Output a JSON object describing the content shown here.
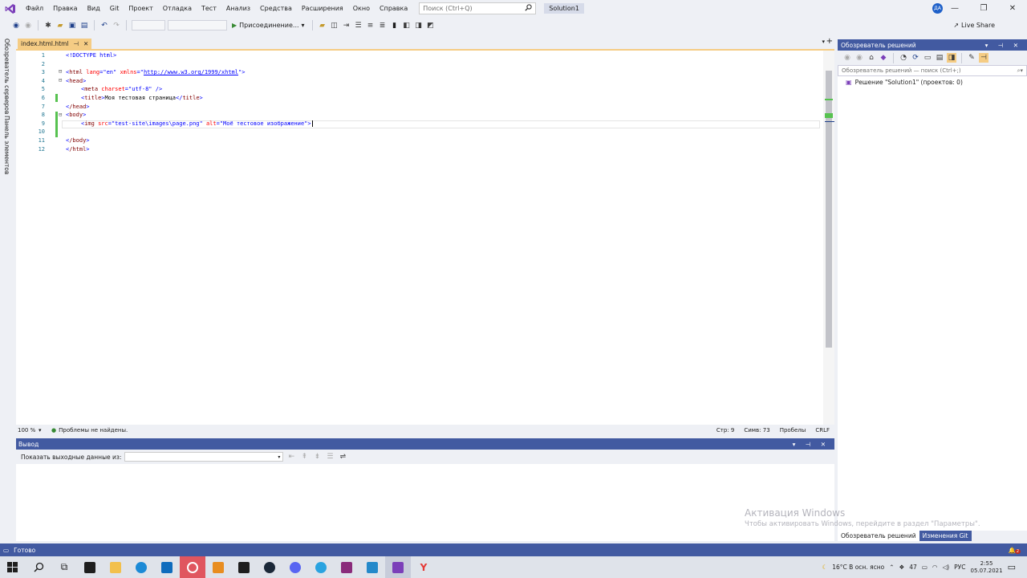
{
  "menu": {
    "items": [
      "Файл",
      "Правка",
      "Вид",
      "Git",
      "Проект",
      "Отладка",
      "Тест",
      "Анализ",
      "Средства",
      "Расширения",
      "Окно",
      "Справка"
    ],
    "search_placeholder": "Поиск (Ctrl+Q)",
    "solution_name": "Solution1",
    "avatar_initials": "ДА"
  },
  "toolbar": {
    "run_label": "Присоединение...",
    "live_share": "Live Share"
  },
  "left_rail": {
    "tab1": "Обозреватель серверов",
    "tab2": "Панель элементов"
  },
  "editor": {
    "tab_name": "index.html.html",
    "zoom": "100 %",
    "issues": "Проблемы не найдены.",
    "line": "Стр: 9",
    "col": "Симв: 73",
    "spaces": "Пробелы",
    "eol": "CRLF"
  },
  "code": {
    "l1_doctype": "<!DOCTYPE html>",
    "l3_open": "<",
    "l3_tag": "html",
    "l3_attr1": " lang",
    "l3_eq1": "=",
    "l3_val1": "\"en\"",
    "l3_attr2": " xmlns",
    "l3_eq2": "=",
    "l3_q1": "\"",
    "l3_link": "http://www.w3.org/1999/xhtml",
    "l3_q2": "\"",
    "l3_close": ">",
    "l4_text": "head",
    "l5_tag": "meta",
    "l5_attr": " charset",
    "l5_val": "\"utf-8\"",
    "l5_close": " />",
    "l6_tag": "title",
    "l6_text": "Моя тестовая страница",
    "l6_endtag": "title",
    "l7_text": "/head",
    "l8_text": "body",
    "l9_tag": "img",
    "l9_attr1": " src",
    "l9_val1": "\"test-site\\images\\page.png\"",
    "l9_attr2": " alt",
    "l9_val2": "\"Моё тестовое изображение\"",
    "l11_text": "/body",
    "l12_text": "/html",
    "line_numbers": [
      "1",
      "2",
      "3",
      "4",
      "5",
      "6",
      "7",
      "8",
      "9",
      "10",
      "11",
      "12"
    ]
  },
  "output": {
    "title": "Вывод",
    "show_from_label": "Показать выходные данные из:"
  },
  "solution_explorer": {
    "title": "Обозреватель решений",
    "search_placeholder": "Обозреватель решений — поиск (Ctrl+;)",
    "solution_item": "Решение \"Solution1\" (проектов: 0)",
    "bottom_tab1": "Обозреватель решений",
    "bottom_tab2": "Изменения Git"
  },
  "watermark": {
    "line1": "Активация Windows",
    "line2": "Чтобы активировать Windows, перейдите в раздел \"Параметры\"."
  },
  "status": {
    "ready": "Готово"
  },
  "taskbar": {
    "weather": "16°C  В осн. ясно",
    "count": "47",
    "lang": "РУС",
    "time": "2:55",
    "date": "05.07.2021",
    "notif_count": "2"
  },
  "colors": {
    "accent": "#425aa1",
    "tab_active": "#f5cc84",
    "change_marker": "#57c250"
  }
}
